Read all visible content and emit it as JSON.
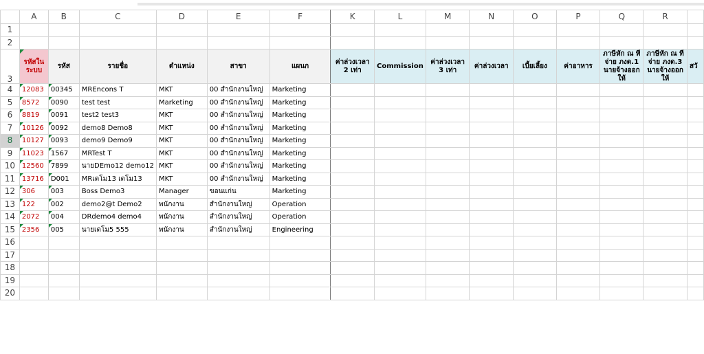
{
  "columns": [
    "A",
    "B",
    "C",
    "D",
    "E",
    "F",
    "K",
    "L",
    "M",
    "N",
    "O",
    "P",
    "Q",
    "R",
    ""
  ],
  "rows": [
    "1",
    "2",
    "3",
    "4",
    "5",
    "6",
    "7",
    "8",
    "9",
    "10",
    "11",
    "12",
    "13",
    "14",
    "15",
    "16",
    "17",
    "18",
    "19",
    "20"
  ],
  "selected_row": "8",
  "headers": {
    "a": "รหัสในระบบ",
    "b": "รหัส",
    "c": "รายชื่อ",
    "d": "ตำแหน่ง",
    "e": "สาขา",
    "f": "แผนก",
    "k": "ค่าล่วงเวลา 2 เท่า",
    "l": "Commission",
    "m": "ค่าล่วงเวลา 3 เท่า",
    "n": "ค่าล่วงเวลา",
    "o": "เบี้ยเลี้ยง",
    "p": "ค่าอาหาร",
    "q": "ภาษีหัก ณ ที่จ่าย ภงด.1 นายจ้างออกให้",
    "r": "ภาษีหัก ณ ที่จ่าย ภงด.3 นายจ้างออกให้",
    "s": "สวั"
  },
  "employees": [
    {
      "sys_id": "12083",
      "code": "00345",
      "name": "MREncons T",
      "position": "MKT",
      "branch": "00 สำนักงานใหญ่",
      "dept": "Marketing"
    },
    {
      "sys_id": "8572",
      "code": "0090",
      "name": "test test",
      "position": "Marketing",
      "branch": "00 สำนักงานใหญ่",
      "dept": "Marketing"
    },
    {
      "sys_id": "8819",
      "code": "0091",
      "name": "test2 test3",
      "position": "MKT",
      "branch": "00 สำนักงานใหญ่",
      "dept": "Marketing"
    },
    {
      "sys_id": "10126",
      "code": "0092",
      "name": "demo8 Demo8",
      "position": "MKT",
      "branch": "00 สำนักงานใหญ่",
      "dept": "Marketing"
    },
    {
      "sys_id": "10127",
      "code": "0093",
      "name": "demo9 Demo9",
      "position": "MKT",
      "branch": "00 สำนักงานใหญ่",
      "dept": "Marketing"
    },
    {
      "sys_id": "11023",
      "code": "1567",
      "name": "MRTest T",
      "position": "MKT",
      "branch": "00 สำนักงานใหญ่",
      "dept": "Marketing"
    },
    {
      "sys_id": "12560",
      "code": "7899",
      "name": "นายDEmo12 demo12",
      "position": "MKT",
      "branch": "00 สำนักงานใหญ่",
      "dept": "Marketing"
    },
    {
      "sys_id": "13716",
      "code": "D001",
      "name": "MRเดโม13 เดโม13",
      "position": "MKT",
      "branch": "00 สำนักงานใหญ่",
      "dept": "Marketing"
    },
    {
      "sys_id": "306",
      "code": "003",
      "name": "Boss Demo3",
      "position": "Manager",
      "branch": "ขอนแก่น",
      "dept": "Marketing"
    },
    {
      "sys_id": "122",
      "code": "002",
      "name": "demo2@t Demo2",
      "position": "พนักงาน",
      "branch": "สำนักงานใหญ่",
      "dept": "Operation"
    },
    {
      "sys_id": "2072",
      "code": "004",
      "name": "DRdemo4 demo4",
      "position": "พนักงาน",
      "branch": "สำนักงานใหญ่",
      "dept": "Operation"
    },
    {
      "sys_id": "2356",
      "code": "005",
      "name": "นายเดโม5 555",
      "position": "พนักงาน",
      "branch": "สำนักงานใหญ่",
      "dept": "Engineering"
    }
  ],
  "colors": {
    "header_pink": "#f4c7cf",
    "header_gray": "#f2f2f2",
    "header_blue": "#daeef3",
    "id_red": "#c00000",
    "comment_green": "#1e8a3e"
  }
}
